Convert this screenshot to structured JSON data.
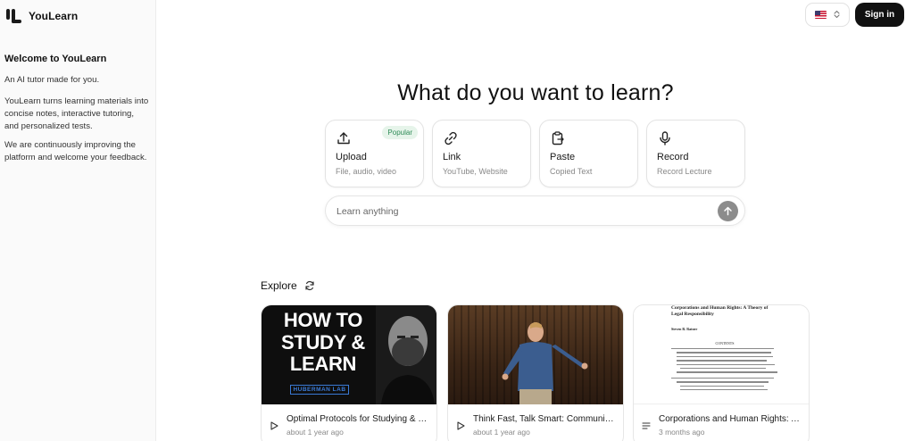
{
  "app": {
    "name": "YouLearn"
  },
  "sidebar": {
    "welcome_title": "Welcome to YouLearn",
    "tagline": "An AI tutor made for you.",
    "description": "YouLearn turns learning materials into concise notes, interactive tutoring, and personalized tests.",
    "feedback": "We are continuously improving the platform and welcome your feedback."
  },
  "header": {
    "language_flag": "us-flag-icon",
    "signin_label": "Sign in"
  },
  "main": {
    "headline": "What do you want to learn?",
    "cards": [
      {
        "title": "Upload",
        "subtitle": "File, audio, video",
        "icon": "upload-icon",
        "badge": "Popular"
      },
      {
        "title": "Link",
        "subtitle": "YouTube, Website",
        "icon": "link-icon"
      },
      {
        "title": "Paste",
        "subtitle": "Copied Text",
        "icon": "paste-icon"
      },
      {
        "title": "Record",
        "subtitle": "Record Lecture",
        "icon": "microphone-icon"
      }
    ],
    "search": {
      "placeholder": "Learn anything"
    }
  },
  "explore": {
    "label": "Explore",
    "items": [
      {
        "title": "Optimal Protocols for Studying & Learning",
        "time": "about 1 year ago",
        "type_icon": "play-icon",
        "thumb_text": "HOW TO STUDY & LEARN",
        "thumb_label": "HUBERMAN LAB"
      },
      {
        "title": "Think Fast, Talk Smart: Communication Techniques",
        "time": "about 1 year ago",
        "type_icon": "play-icon"
      },
      {
        "title": "Corporations and Human Rights: A Theory of Legal Responsibility",
        "time": "3 months ago",
        "type_icon": "document-lines-icon",
        "doc_title": "Corporations and Human Rights: A Theory of Legal Responsibility",
        "doc_author": "Steven R. Ratner",
        "doc_contents_label": "CONTENTS"
      }
    ]
  },
  "colors": {
    "accent_dark": "#111111",
    "badge_bg": "#e6f4ea",
    "badge_text": "#2e8b57",
    "send_button": "#8c8c8c"
  }
}
